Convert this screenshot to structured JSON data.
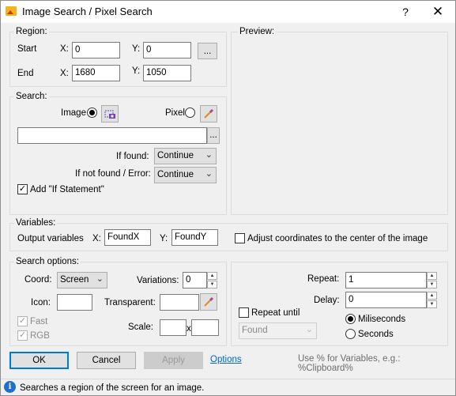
{
  "window": {
    "title": "Image Search / Pixel Search",
    "help": "?",
    "close": "✕"
  },
  "region": {
    "label": "Region:",
    "start_label": "Start",
    "end_label": "End",
    "x_label": "X:",
    "y_label": "Y:",
    "start_x": "0",
    "start_y": "0",
    "end_x": "1680",
    "end_y": "1050",
    "browse": "..."
  },
  "preview": {
    "label": "Preview:"
  },
  "search": {
    "label": "Search:",
    "image_label": "Image",
    "pixel_label": "Pixel",
    "file_value": "",
    "browse": "...",
    "if_found_label": "If found:",
    "if_found_value": "Continue",
    "if_not_found_label": "If not found / Error:",
    "if_not_found_value": "Continue",
    "add_if_label": "Add \"If Statement\""
  },
  "variables": {
    "label": "Variables:",
    "output_label": "Output variables",
    "x_label": "X:",
    "x_value": "FoundX",
    "y_label": "Y:",
    "y_value": "FoundY",
    "center_label": "Adjust coordinates to the center of the image"
  },
  "search_options": {
    "label": "Search options:",
    "coord_label": "Coord:",
    "coord_value": "Screen",
    "variations_label": "Variations:",
    "variations_value": "0",
    "icon_label": "Icon:",
    "icon_value": "",
    "transparent_label": "Transparent:",
    "transparent_value": "",
    "fast_label": "Fast",
    "rgb_label": "RGB",
    "scale_label": "Scale:",
    "scale_w": "",
    "scale_x": "x",
    "scale_h": ""
  },
  "repeat": {
    "repeat_label": "Repeat:",
    "repeat_value": "1",
    "delay_label": "Delay:",
    "delay_value": "0",
    "repeat_until_label": "Repeat until",
    "until_value": "Found",
    "ms_label": "Miliseconds",
    "sec_label": "Seconds"
  },
  "buttons": {
    "ok": "OK",
    "cancel": "Cancel",
    "apply": "Apply",
    "options": "Options"
  },
  "hint": "Use % for Variables, e.g.: %Clipboard%",
  "status": {
    "text": "Searches a region of the screen for an image.",
    "icon": "i"
  }
}
